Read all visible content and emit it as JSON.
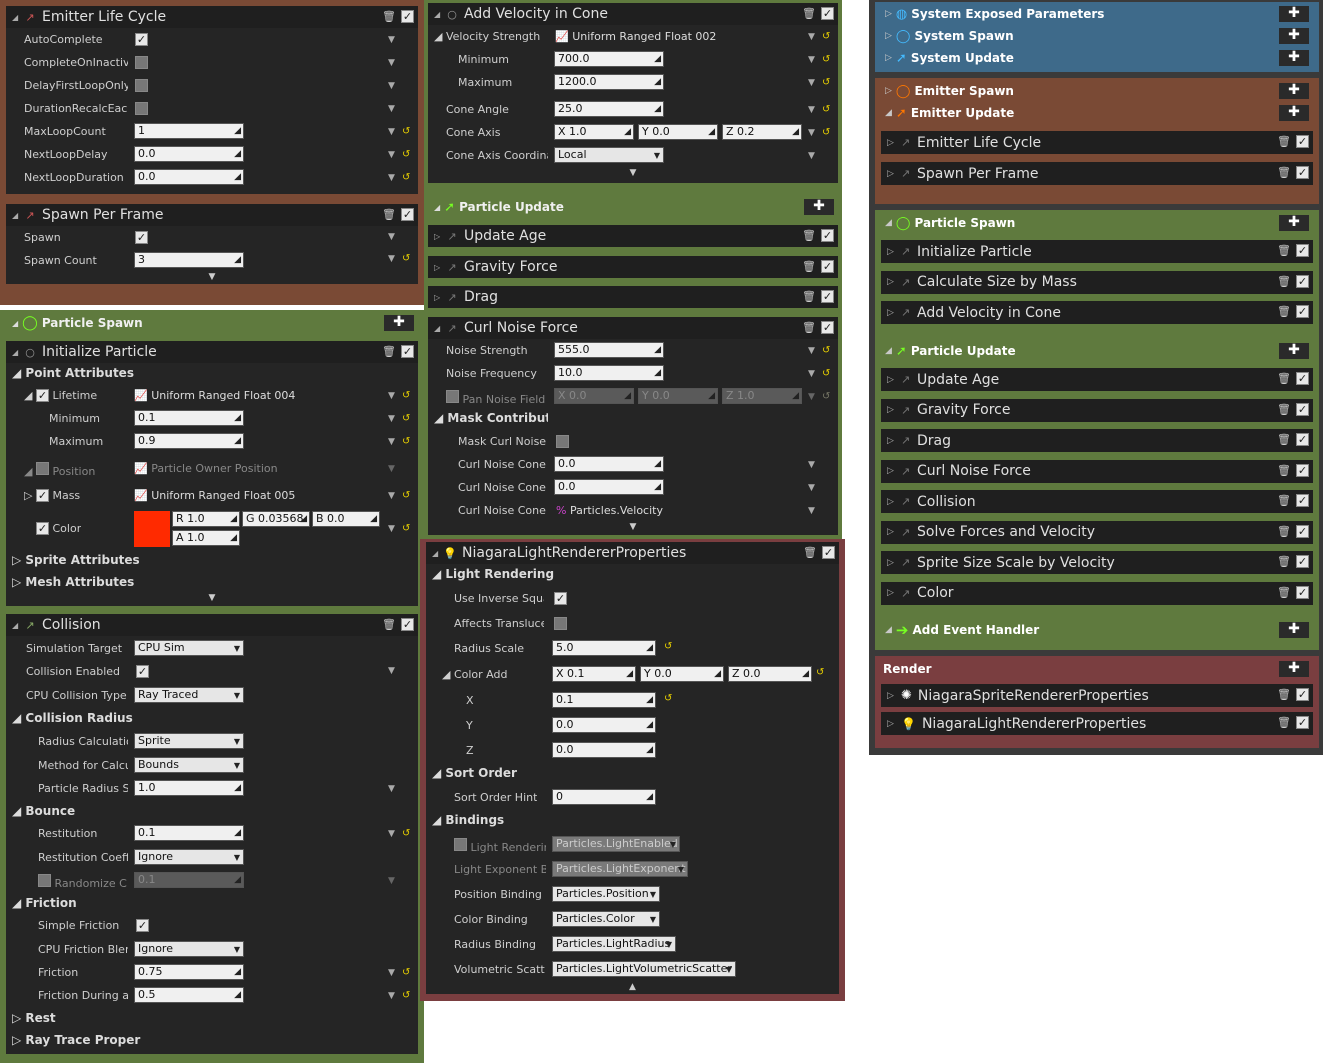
{
  "col1": {
    "emitter_life_cycle": {
      "title": "Emitter Life Cycle",
      "rows": [
        {
          "label": "AutoComplete",
          "type": "check",
          "on": true
        },
        {
          "label": "CompleteOnInactive",
          "type": "check",
          "on": false
        },
        {
          "label": "DelayFirstLoopOnly",
          "type": "check",
          "on": false
        },
        {
          "label": "DurationRecalcEach",
          "type": "check",
          "on": false
        },
        {
          "label": "MaxLoopCount",
          "type": "num",
          "value": "1"
        },
        {
          "label": "NextLoopDelay",
          "type": "num",
          "value": "0.0"
        },
        {
          "label": "NextLoopDuration",
          "type": "num",
          "value": "0.0"
        }
      ]
    },
    "spawn_per_frame": {
      "title": "Spawn Per Frame",
      "spawn_label": "Spawn",
      "count_label": "Spawn Count",
      "count_value": "3"
    },
    "particle_spawn_label": "Particle Spawn",
    "initialize_particle": {
      "title": "Initialize Particle",
      "point_attributes": "Point Attributes",
      "lifetime": "Lifetime",
      "lifetime_value": "Uniform Ranged Float 004",
      "minimum": "Minimum",
      "min_value": "0.1",
      "maximum": "Maximum",
      "max_value": "0.9",
      "position": "Position",
      "position_value": "Particle Owner Position",
      "mass": "Mass",
      "mass_value": "Uniform Ranged Float 005",
      "color": "Color",
      "r": "R 1.0",
      "g": "G 0.03568",
      "b": "B 0.0",
      "a": "A 1.0",
      "sprite_attributes": "Sprite Attributes",
      "mesh_attributes": "Mesh Attributes"
    },
    "collision": {
      "title": "Collision",
      "sim_target": "Simulation Target",
      "sim_target_value": "CPU Sim",
      "collision_enabled": "Collision Enabled",
      "cpu_type": "CPU Collision Type",
      "cpu_type_value": "Ray Traced",
      "collision_radius": "Collision Radius",
      "radius_calc": "Radius Calculatio",
      "radius_calc_value": "Sprite",
      "method": "Method for Calcu",
      "method_value": "Bounds",
      "particle_radius": "Particle Radius S",
      "particle_radius_value": "1.0",
      "bounce": "Bounce",
      "restitution": "Restitution",
      "restitution_value": "0.1",
      "restitution_coeff": "Restitution Coeffi",
      "restitution_coeff_value": "Ignore",
      "randomize": "Randomize C",
      "randomize_value": "0.1",
      "friction_sec": "Friction",
      "simple_friction": "Simple Friction",
      "cpu_friction": "CPU Friction Blen",
      "cpu_friction_value": "Ignore",
      "friction": "Friction",
      "friction_value": "0.75",
      "friction_during": "Friction During a I",
      "friction_during_value": "0.5",
      "rest": "Rest",
      "ray_trace": "Ray Trace Proper"
    }
  },
  "col2": {
    "add_velocity": {
      "title": "Add Velocity in Cone",
      "velocity_strength": "Velocity Strength",
      "velocity_value": "Uniform Ranged Float 002",
      "minimum": "Minimum",
      "min_value": "700.0",
      "maximum": "Maximum",
      "max_value": "1200.0",
      "cone_angle": "Cone Angle",
      "cone_angle_value": "25.0",
      "cone_axis": "Cone Axis",
      "x": "X 1.0",
      "y": "Y 0.0",
      "z": "Z 0.2",
      "cone_coord": "Cone Axis Coordinat",
      "cone_coord_value": "Local"
    },
    "particle_update_label": "Particle Update",
    "update_age": "Update Age",
    "gravity": "Gravity Force",
    "drag": "Drag",
    "curl": {
      "title": "Curl Noise Force",
      "noise_strength": "Noise Strength",
      "noise_strength_value": "555.0",
      "noise_freq": "Noise Frequency",
      "noise_freq_value": "10.0",
      "pan": "Pan Noise Field",
      "px": "X 0.0",
      "py": "Y 0.0",
      "pz": "Z 1.0",
      "mask_contrib": "Mask Contributio",
      "mask_curl": "Mask Curl Noise",
      "cone1": "Curl Noise Cone I",
      "cone1_value": "0.0",
      "cone2": "Curl Noise Cone I",
      "cone2_value": "0.0",
      "cone3": "Curl Noise Cone I",
      "cone3_value": "Particles.Velocity"
    },
    "light": {
      "title": "NiagaraLightRendererProperties",
      "light_rendering": "Light Rendering",
      "inverse": "Use Inverse Squa",
      "translucent": "Affects Transluce",
      "radius_scale": "Radius Scale",
      "radius_scale_value": "5.0",
      "color_add": "Color Add",
      "cx": "X 0.1",
      "cy": "Y 0.0",
      "cz": "Z 0.0",
      "x": "X",
      "x_value": "0.1",
      "y": "Y",
      "y_value": "0.0",
      "z": "Z",
      "z_value": "0.0",
      "sort_order": "Sort Order",
      "sort_hint": "Sort Order Hint",
      "sort_hint_value": "0",
      "bindings": "Bindings",
      "b1": "Light Renderir",
      "b1_value": "Particles.LightEnabled",
      "b2": "Light Exponent Bi",
      "b2_value": "Particles.LightExponent",
      "b3": "Position Binding",
      "b3_value": "Particles.Position",
      "b4": "Color Binding",
      "b4_value": "Particles.Color",
      "b5": "Radius Binding",
      "b5_value": "Particles.LightRadius",
      "b6": "Volumetric Scatt",
      "b6_value": "Particles.LightVolumetricScatter"
    }
  },
  "col3": {
    "system": [
      "System Exposed Parameters",
      "System Spawn",
      "System Update"
    ],
    "emitter_spawn": "Emitter Spawn",
    "emitter_update": "Emitter Update",
    "emitter_items": [
      "Emitter Life Cycle",
      "Spawn Per Frame"
    ],
    "particle_spawn": "Particle Spawn",
    "spawn_items": [
      "Initialize Particle",
      "Calculate Size by Mass",
      "Add Velocity in Cone"
    ],
    "particle_update": "Particle Update",
    "update_items": [
      "Update Age",
      "Gravity Force",
      "Drag",
      "Curl Noise Force",
      "Collision",
      "Solve Forces and Velocity",
      "Sprite Size Scale by Velocity",
      "Color"
    ],
    "add_event": "Add Event Handler",
    "render": "Render",
    "render_items": [
      "NiagaraSpriteRendererProperties",
      "NiagaraLightRendererProperties"
    ]
  }
}
